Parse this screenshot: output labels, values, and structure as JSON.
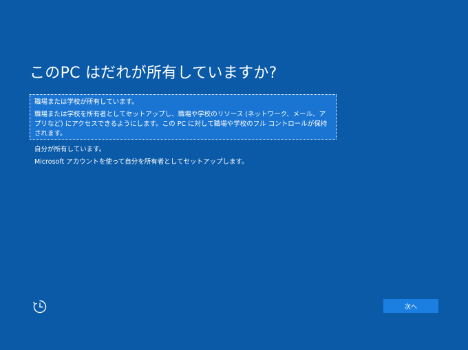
{
  "header": {
    "title": "このPC はだれが所有していますか?"
  },
  "options": [
    {
      "title": "職場または学校が所有しています。",
      "description": "職場または学校を所有者としてセットアップし、職場や学校のリソース (ネットワーク、メール、アプリなど) にアクセスできるようにします。この PC に対して職場や学校のフル コントロールが保持されます。",
      "selected": true
    },
    {
      "title": "自分が所有しています。",
      "description": "Microsoft アカウントを使って自分を所有者としてセットアップします。",
      "selected": false
    }
  ],
  "footer": {
    "ease_of_access_icon": "ease-of-access-icon",
    "next_label": "次へ"
  },
  "colors": {
    "background": "#0a5aa8",
    "selected_option": "#1a75d2",
    "button": "#1a7fe0"
  }
}
